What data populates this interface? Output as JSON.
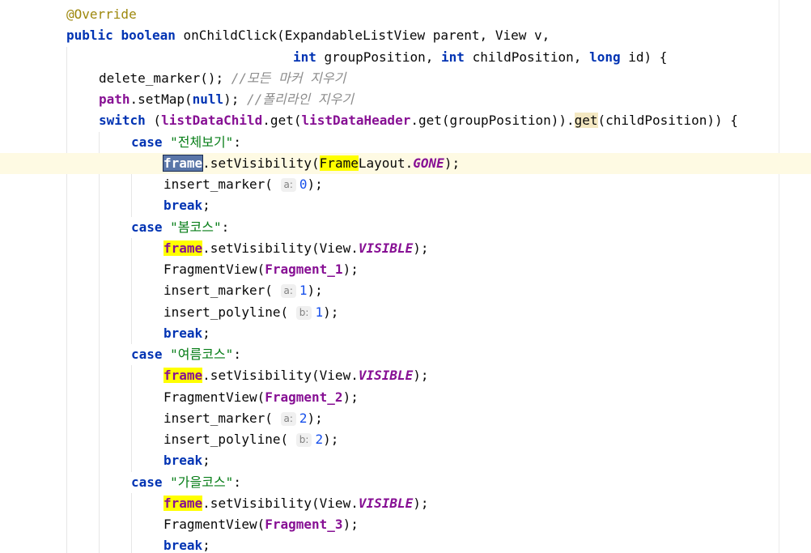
{
  "editor": {
    "lines": [
      {
        "parts": [
          {
            "t": "@Override",
            "c": "ann"
          }
        ]
      },
      {
        "parts": [
          {
            "t": "public",
            "c": "kw"
          },
          {
            "t": " "
          },
          {
            "t": "boolean",
            "c": "kw"
          },
          {
            "t": " onChildClick(ExpandableListView parent, View v,"
          }
        ]
      },
      {
        "parts": [
          {
            "t": "int",
            "c": "kw"
          },
          {
            "t": " groupPosition, "
          },
          {
            "t": "int",
            "c": "kw"
          },
          {
            "t": " childPosition, "
          },
          {
            "t": "long",
            "c": "kw"
          },
          {
            "t": " id) {"
          }
        ]
      },
      {
        "parts": [
          {
            "t": "delete_marker(); "
          },
          {
            "t": "//모든 마커 지우기",
            "c": "cmt"
          }
        ]
      },
      {
        "parts": [
          {
            "t": "path",
            "c": "fld"
          },
          {
            "t": ".setMap("
          },
          {
            "t": "null",
            "c": "kw"
          },
          {
            "t": "); "
          },
          {
            "t": "//폴리라인 지우기",
            "c": "cmt"
          }
        ]
      },
      {
        "parts": [
          {
            "t": "switch",
            "c": "kw"
          },
          {
            "t": " ("
          },
          {
            "t": "listDataChild",
            "c": "fld"
          },
          {
            "t": ".get("
          },
          {
            "t": "listDataHeader",
            "c": "fld"
          },
          {
            "t": ".get(groupPosition))."
          },
          {
            "t": "get",
            "c": "match"
          },
          {
            "t": "(childPosition)) {"
          }
        ]
      },
      {
        "parts": [
          {
            "t": "case",
            "c": "kw"
          },
          {
            "t": " "
          },
          {
            "t": "\"전체보기\"",
            "c": "str"
          },
          {
            "t": ":"
          }
        ]
      },
      {
        "parts": [
          {
            "t": "frame",
            "c": "fld hl-sel"
          },
          {
            "t": ".setVisibility("
          },
          {
            "t": "Frame",
            "c": "hl"
          },
          {
            "t": "Layout."
          },
          {
            "t": "GONE",
            "c": "sfld"
          },
          {
            "t": ");"
          }
        ]
      },
      {
        "parts": [
          {
            "t": "insert_marker( "
          },
          {
            "t": "a:",
            "c": "hint"
          },
          {
            "t": "0",
            "c": "num"
          },
          {
            "t": ");"
          }
        ]
      },
      {
        "parts": [
          {
            "t": "break",
            "c": "kw"
          },
          {
            "t": ";"
          }
        ]
      },
      {
        "parts": [
          {
            "t": "case",
            "c": "kw"
          },
          {
            "t": " "
          },
          {
            "t": "\"봄코스\"",
            "c": "str"
          },
          {
            "t": ":"
          }
        ]
      },
      {
        "parts": [
          {
            "t": "frame",
            "c": "fld hl"
          },
          {
            "t": ".setVisibility(View."
          },
          {
            "t": "VISIBLE",
            "c": "sfld"
          },
          {
            "t": ");"
          }
        ]
      },
      {
        "parts": [
          {
            "t": "FragmentView("
          },
          {
            "t": "Fragment_1",
            "c": "fld"
          },
          {
            "t": ");"
          }
        ]
      },
      {
        "parts": [
          {
            "t": "insert_marker( "
          },
          {
            "t": "a:",
            "c": "hint"
          },
          {
            "t": "1",
            "c": "num"
          },
          {
            "t": ");"
          }
        ]
      },
      {
        "parts": [
          {
            "t": "insert_polyline( "
          },
          {
            "t": "b:",
            "c": "hint"
          },
          {
            "t": "1",
            "c": "num"
          },
          {
            "t": ");"
          }
        ]
      },
      {
        "parts": [
          {
            "t": "break",
            "c": "kw"
          },
          {
            "t": ";"
          }
        ]
      },
      {
        "parts": [
          {
            "t": "case",
            "c": "kw"
          },
          {
            "t": " "
          },
          {
            "t": "\"여름코스\"",
            "c": "str"
          },
          {
            "t": ":"
          }
        ]
      },
      {
        "parts": [
          {
            "t": "frame",
            "c": "fld hl"
          },
          {
            "t": ".setVisibility(View."
          },
          {
            "t": "VISIBLE",
            "c": "sfld"
          },
          {
            "t": ");"
          }
        ]
      },
      {
        "parts": [
          {
            "t": "FragmentView("
          },
          {
            "t": "Fragment_2",
            "c": "fld"
          },
          {
            "t": ");"
          }
        ]
      },
      {
        "parts": [
          {
            "t": "insert_marker( "
          },
          {
            "t": "a:",
            "c": "hint"
          },
          {
            "t": "2",
            "c": "num"
          },
          {
            "t": ");"
          }
        ]
      },
      {
        "parts": [
          {
            "t": "insert_polyline( "
          },
          {
            "t": "b:",
            "c": "hint"
          },
          {
            "t": "2",
            "c": "num"
          },
          {
            "t": ");"
          }
        ]
      },
      {
        "parts": [
          {
            "t": "break",
            "c": "kw"
          },
          {
            "t": ";"
          }
        ]
      },
      {
        "parts": [
          {
            "t": "case",
            "c": "kw"
          },
          {
            "t": " "
          },
          {
            "t": "\"가을코스\"",
            "c": "str"
          },
          {
            "t": ":"
          }
        ]
      },
      {
        "parts": [
          {
            "t": "frame",
            "c": "fld hl"
          },
          {
            "t": ".setVisibility(View."
          },
          {
            "t": "VISIBLE",
            "c": "sfld"
          },
          {
            "t": ");"
          }
        ]
      },
      {
        "parts": [
          {
            "t": "FragmentView("
          },
          {
            "t": "Fragment_3",
            "c": "fld"
          },
          {
            "t": ");"
          }
        ]
      },
      {
        "parts": [
          {
            "t": "break",
            "c": "kw"
          },
          {
            "t": ";"
          }
        ]
      }
    ],
    "current_line": 8,
    "colors": {
      "keyword": "#0033b3",
      "annotation": "#9e880d",
      "comment": "#8c8c8c",
      "string": "#067d17",
      "number": "#1750eb",
      "field": "#871094",
      "search_highlight": "#ffff00",
      "current_line_bg": "#fefae3"
    }
  }
}
